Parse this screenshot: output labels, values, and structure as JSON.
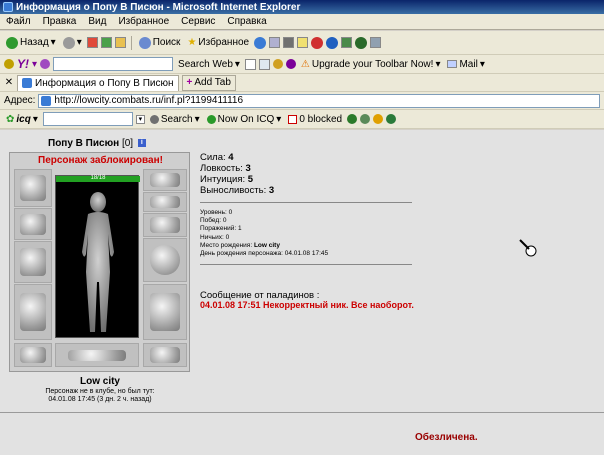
{
  "window": {
    "title": "Информация о Попу В Писюн - Microsoft Internet Explorer"
  },
  "menu": [
    "Файл",
    "Правка",
    "Вид",
    "Избранное",
    "Сервис",
    "Справка"
  ],
  "toolbar": {
    "back": "Назад",
    "search": "Поиск",
    "favorites": "Избранное",
    "search_web": "Search Web",
    "upgrade": "Upgrade your Toolbar Now!",
    "mail": "Mail"
  },
  "tabs": {
    "current": "Информация о Попу В Писюн",
    "add": "Add Tab"
  },
  "address": {
    "label": "Адрес:",
    "url": "http://lowcity.combats.ru/inf.pl?1199411116"
  },
  "icq_bar": {
    "brand": "icq",
    "search": "Search",
    "now_on": "Now On ICQ",
    "blocked": "0 blocked"
  },
  "character": {
    "name": "Попу В Писюн",
    "level": "[0]",
    "status_blocked": "Персонаж заблокирован!",
    "hp": "18/18",
    "hp_fraction": 1.0,
    "city": "Low city",
    "offline_line1": "Персонаж не в клубе, но был тут:",
    "offline_line2": "04.01.08 17:45 (3 дн. 2 ч. назад)"
  },
  "stats": [
    {
      "label": "Сила:",
      "value": "4"
    },
    {
      "label": "Ловкость:",
      "value": "3"
    },
    {
      "label": "Интуиция:",
      "value": "5"
    },
    {
      "label": "Выносливость:",
      "value": "3"
    }
  ],
  "details": [
    {
      "label": "Уровень:",
      "value": "0"
    },
    {
      "label": "Побед:",
      "value": "0"
    },
    {
      "label": "Поражений:",
      "value": "1"
    },
    {
      "label": "Ничьих:",
      "value": "0"
    },
    {
      "label": "Место рождения:",
      "value": "Low city"
    },
    {
      "label": "День рождения персонажа:",
      "value": "04.01.08 17:45"
    }
  ],
  "paladin": {
    "header": "Сообщение от паладинов :",
    "message": "04.01.08 17:51 Некорректный ник. Все наоборот."
  },
  "footer_status": "Обезличена."
}
